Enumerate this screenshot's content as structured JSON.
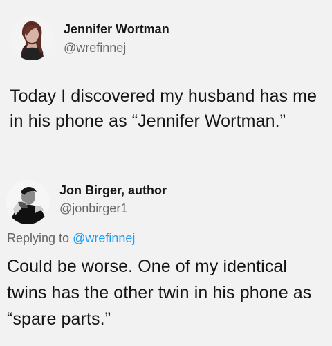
{
  "tweet": {
    "author_name": "Jennifer Wortman",
    "author_handle": "@wrefinnej",
    "text": "Today I discovered my husband has me in his phone as “Jennifer Wortman.”"
  },
  "reply": {
    "author_name": "Jon Birger, author",
    "author_handle": "@jonbirger1",
    "replying_prefix": "Replying to",
    "replying_handle": "@wrefinnej",
    "text": "Could be worse. One of my identical twins has the other twin in his phone as “spare parts.”"
  },
  "colors": {
    "background": "#f2f2f2",
    "text": "#151515",
    "muted": "#666666",
    "link": "#1d9bf0"
  }
}
